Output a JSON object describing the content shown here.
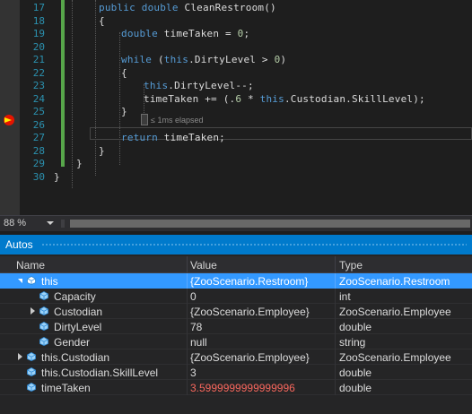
{
  "editor": {
    "lines": [
      {
        "num": "17",
        "tokens": [
          {
            "t": "public double ",
            "c": "kw"
          },
          {
            "t": "CleanRestroom()",
            "c": ""
          }
        ],
        "indent": 0
      },
      {
        "num": "18",
        "tokens": [
          {
            "t": "{",
            "c": ""
          }
        ],
        "indent": 0
      },
      {
        "num": "19",
        "tokens": [
          {
            "t": "double ",
            "c": "kw"
          },
          {
            "t": "timeTaken = ",
            "c": ""
          },
          {
            "t": "0",
            "c": "num"
          },
          {
            "t": ";",
            "c": ""
          }
        ],
        "indent": 1
      },
      {
        "num": "20",
        "tokens": [],
        "indent": 1
      },
      {
        "num": "21",
        "tokens": [
          {
            "t": "while ",
            "c": "kw"
          },
          {
            "t": "(",
            "c": ""
          },
          {
            "t": "this",
            "c": "kw"
          },
          {
            "t": ".DirtyLevel > ",
            "c": ""
          },
          {
            "t": "0",
            "c": "num"
          },
          {
            "t": ")",
            "c": ""
          }
        ],
        "indent": 1
      },
      {
        "num": "22",
        "tokens": [
          {
            "t": "{",
            "c": ""
          }
        ],
        "indent": 1
      },
      {
        "num": "23",
        "tokens": [
          {
            "t": "this",
            "c": "kw"
          },
          {
            "t": ".DirtyLevel--;",
            "c": ""
          }
        ],
        "indent": 2
      },
      {
        "num": "24",
        "tokens": [
          {
            "t": "timeTaken += (.",
            "c": ""
          },
          {
            "t": "6",
            "c": "num"
          },
          {
            "t": " * ",
            "c": ""
          },
          {
            "t": "this",
            "c": "kw"
          },
          {
            "t": ".Custodian.SkillLevel);",
            "c": ""
          }
        ],
        "indent": 2
      },
      {
        "num": "25",
        "tokens": [
          {
            "t": "}",
            "c": ""
          }
        ],
        "indent": 1
      },
      {
        "num": "26",
        "tokens": [],
        "indent": 1
      },
      {
        "num": "27",
        "tokens": [
          {
            "t": "return ",
            "c": "kw"
          },
          {
            "t": "timeTaken;",
            "c": ""
          }
        ],
        "indent": 1
      },
      {
        "num": "28",
        "tokens": [
          {
            "t": "}",
            "c": ""
          }
        ],
        "indent": 0
      },
      {
        "num": "29",
        "tokens": [
          {
            "t": "}",
            "c": ""
          }
        ],
        "indent": -1
      },
      {
        "num": "30",
        "tokens": [
          {
            "t": "}",
            "c": ""
          }
        ],
        "indent": -2
      }
    ],
    "perf_tip": "≤ 1ms elapsed"
  },
  "zoom": {
    "level": "88 %"
  },
  "autos": {
    "title": "Autos",
    "columns": {
      "name": "Name",
      "value": "Value",
      "type": "Type"
    },
    "rows": [
      {
        "name": "this",
        "value": "{ZooScenario.Restroom}",
        "type": "ZooScenario.Restroom",
        "level": 0,
        "expander": "open",
        "selected": true,
        "icon": "object-icon"
      },
      {
        "name": "Capacity",
        "value": "0",
        "type": "int",
        "level": 1,
        "expander": "",
        "icon": "property-icon"
      },
      {
        "name": "Custodian",
        "value": "{ZooScenario.Employee}",
        "type": "ZooScenario.Employee",
        "level": 1,
        "expander": "closed",
        "icon": "property-icon"
      },
      {
        "name": "DirtyLevel",
        "value": "78",
        "type": "double",
        "level": 1,
        "expander": "",
        "icon": "property-icon"
      },
      {
        "name": "Gender",
        "value": "null",
        "type": "string",
        "level": 1,
        "expander": "",
        "icon": "property-icon"
      },
      {
        "name": "this.Custodian",
        "value": "{ZooScenario.Employee}",
        "type": "ZooScenario.Employee",
        "level": 0,
        "expander": "closed",
        "icon": "property-icon"
      },
      {
        "name": "this.Custodian.SkillLevel",
        "value": "3",
        "type": "double",
        "level": 0,
        "expander": "",
        "icon": "property-icon"
      },
      {
        "name": "timeTaken",
        "value": "3.5999999999999996",
        "type": "double",
        "level": 0,
        "expander": "",
        "icon": "property-icon",
        "changed": true
      }
    ]
  },
  "colors": {
    "accent": "#007acc",
    "selection": "#3399ff",
    "keyword": "#569cd6",
    "line_number": "#2b91af",
    "changed_value": "#f8675d",
    "breakpoint": "#e51400"
  }
}
